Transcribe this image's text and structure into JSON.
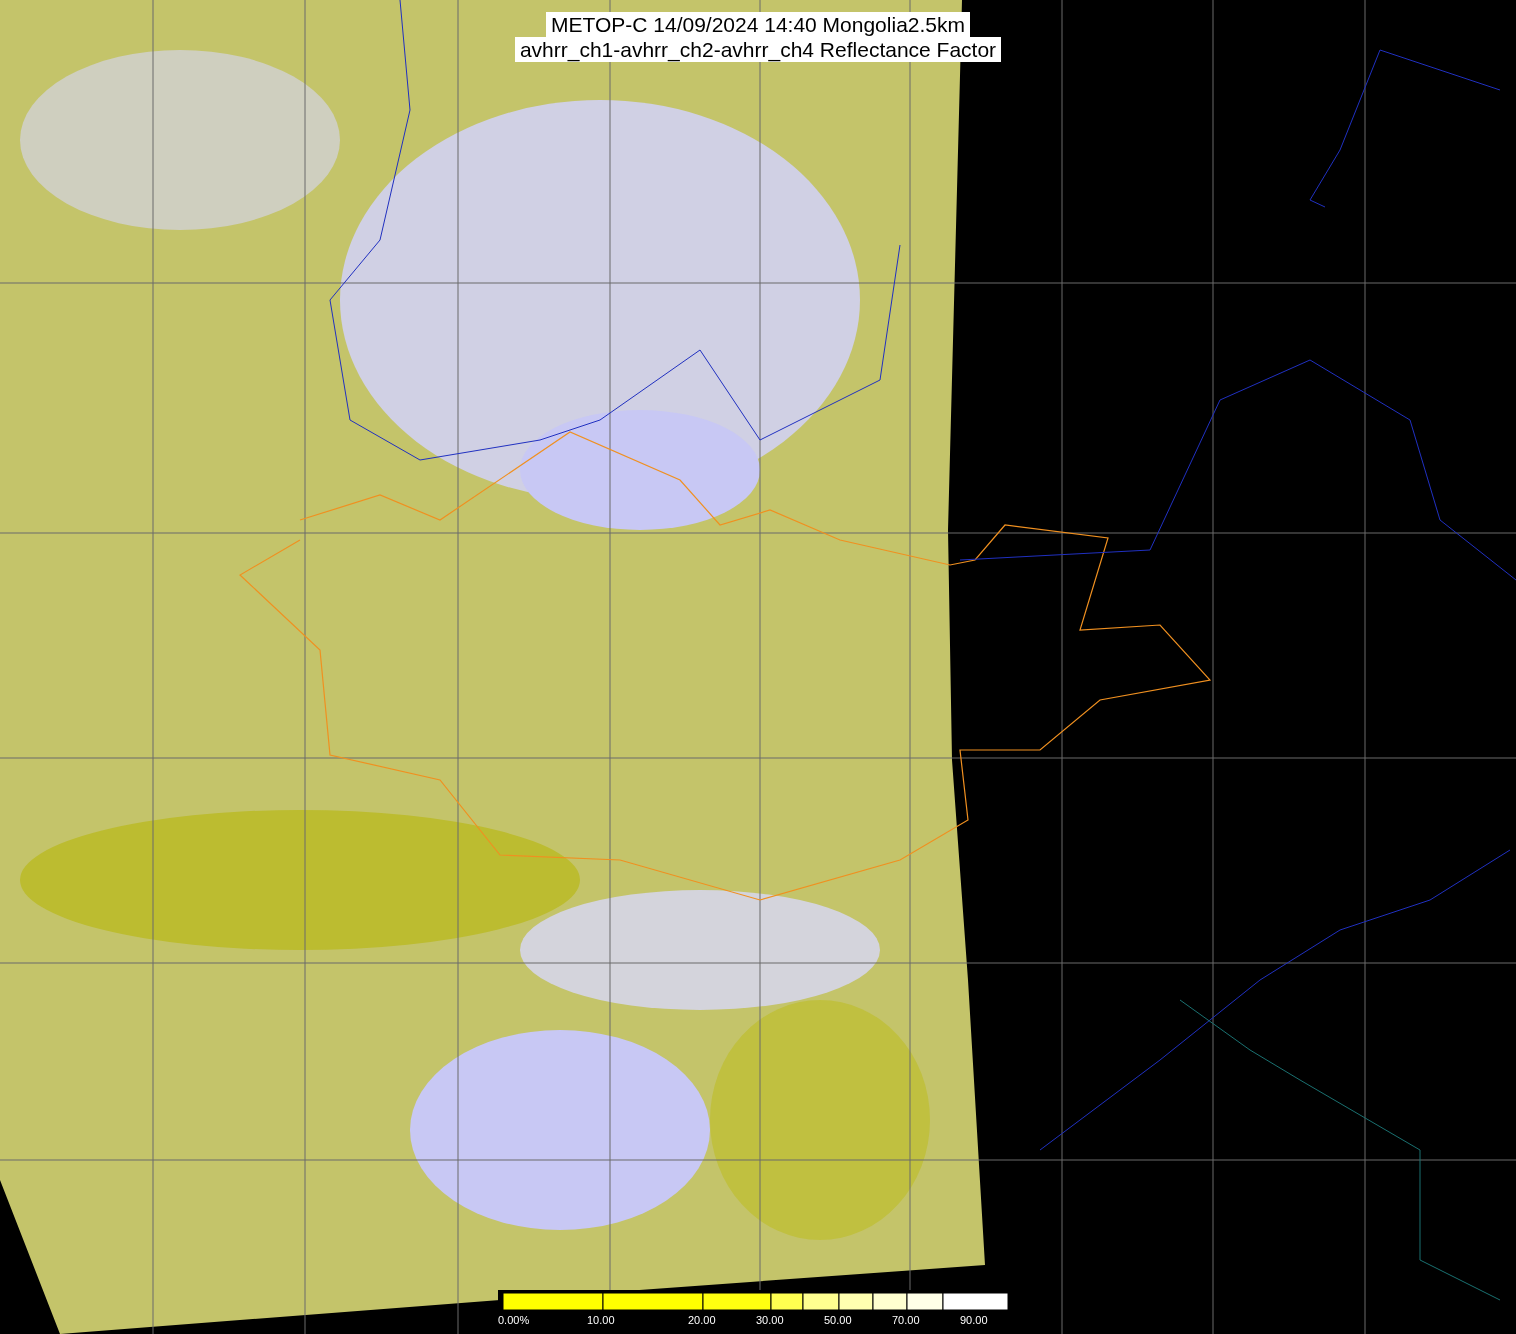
{
  "title": {
    "lines": [
      "METOP-C 14/09/2024 14:40 Mongolia2.5km",
      "avhrr_ch1-avhrr_ch2-avhrr_ch4 Reflectance Factor"
    ]
  },
  "legend": {
    "labels": [
      "0.00%",
      "10.00",
      "20.00",
      "30.00",
      "50.00",
      "70.00",
      "90.00"
    ]
  }
}
